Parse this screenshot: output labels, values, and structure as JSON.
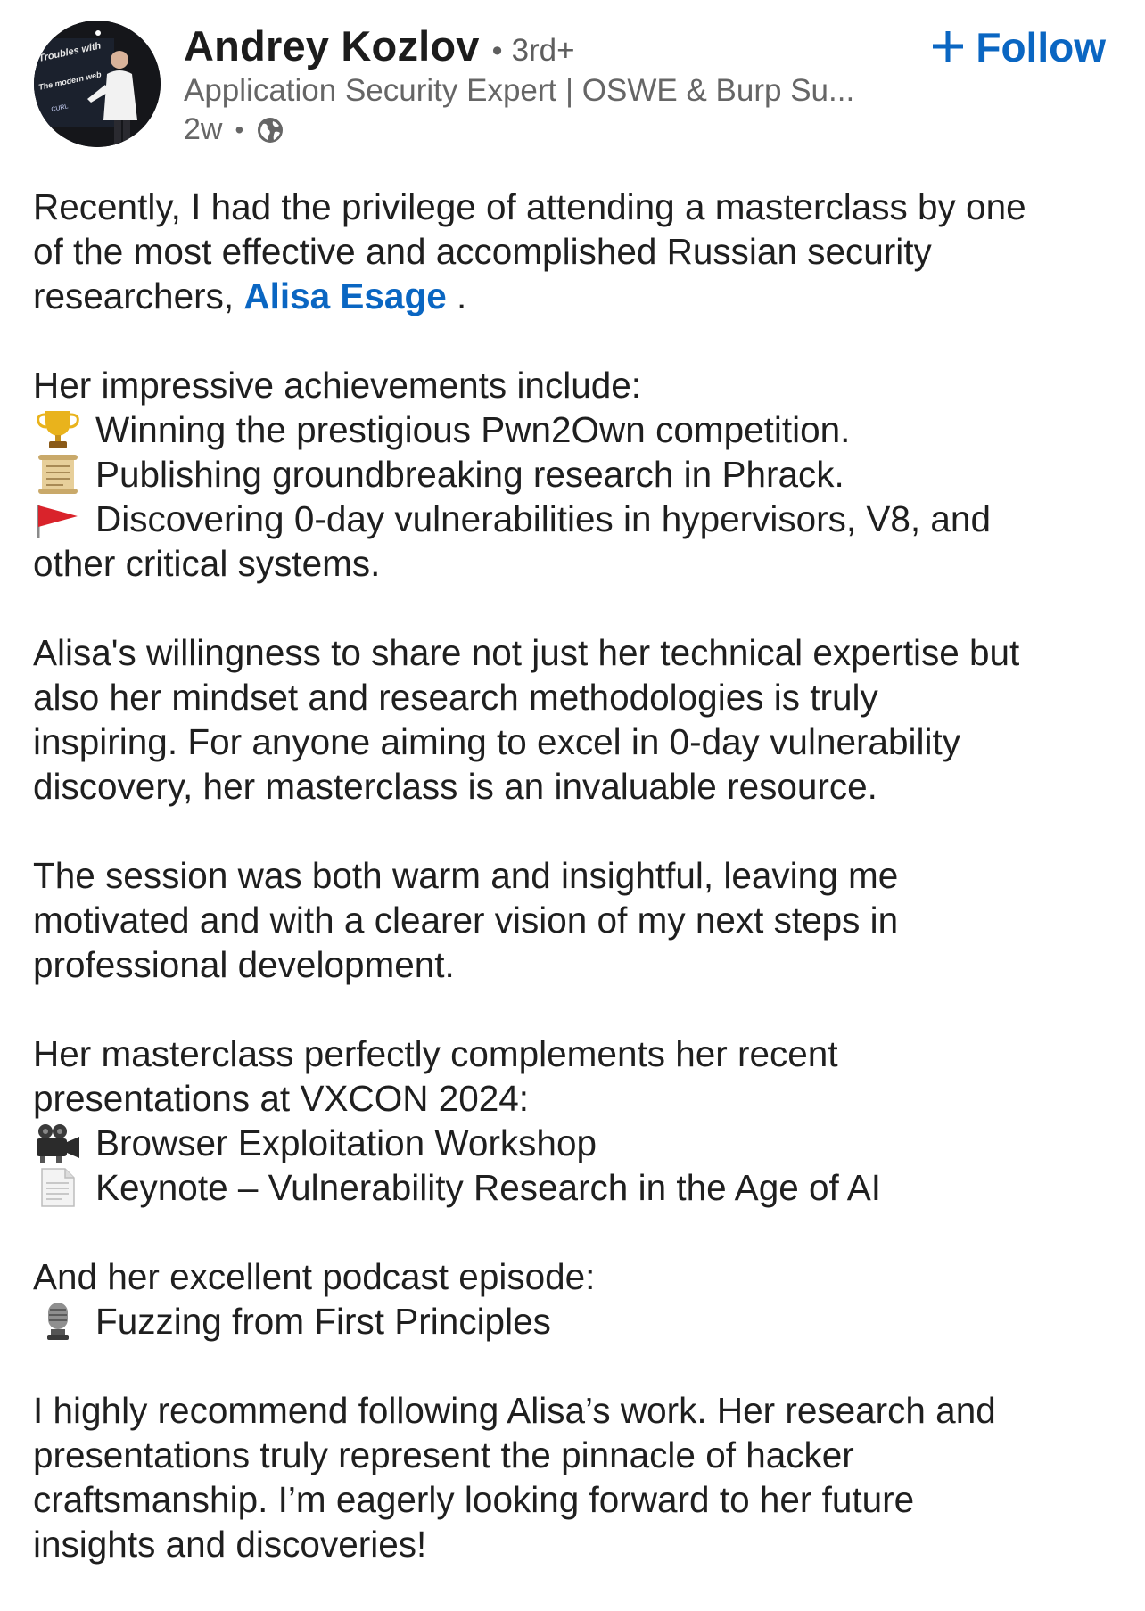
{
  "author": {
    "name": "Andrey Kozlov",
    "degree": "3rd+",
    "headline": "Application Security Expert | OSWE & Burp Su...",
    "time_ago": "2w",
    "avatar_slide_text": [
      "Troubles with",
      "The modern web",
      "CURL"
    ]
  },
  "follow": {
    "label": "Follow",
    "icon": "plus-icon"
  },
  "visibility_icon": "globe-icon",
  "colors": {
    "link": "#0a66c2",
    "text": "#1f1f1f",
    "muted": "#666666"
  },
  "post": {
    "intro": {
      "line1": "Recently, I had the privilege of attending a masterclass by one",
      "line2": "of the most effective and accomplished Russian security",
      "line3_before": "researchers, ",
      "mention": "Alisa Esage",
      "line3_after": " ."
    },
    "achievements": {
      "heading": "Her impressive achievements include:",
      "items": [
        {
          "icon": "trophy-icon",
          "text": "Winning the prestigious Pwn2Own competition."
        },
        {
          "icon": "scroll-icon",
          "text": "Publishing groundbreaking research in Phrack."
        },
        {
          "icon": "flag-icon",
          "text": "Discovering 0-day vulnerabilities in hypervisors, V8, and"
        }
      ],
      "continuation": "other critical systems."
    },
    "para2": [
      "Alisa's willingness to share not just her technical expertise but",
      "also her mindset and research methodologies is truly",
      "inspiring. For anyone aiming to excel in 0-day vulnerability",
      "discovery, her masterclass is an invaluable resource."
    ],
    "para3": [
      "The session was both warm and insightful, leaving me",
      "motivated and with a clearer vision of my next steps in",
      "professional development."
    ],
    "presentations": {
      "lines": [
        "Her masterclass perfectly complements her recent",
        "presentations at VXCON 2024:"
      ],
      "items": [
        {
          "icon": "movie-camera-icon",
          "text": "Browser Exploitation Workshop"
        },
        {
          "icon": "document-icon",
          "text": "Keynote – Vulnerability Research in the Age of AI"
        }
      ]
    },
    "podcast": {
      "heading": "And her excellent podcast episode:",
      "items": [
        {
          "icon": "microphone-icon",
          "text": "Fuzzing from First Principles"
        }
      ]
    },
    "closing": [
      "I highly recommend following Alisa’s work. Her research and",
      "presentations truly represent the pinnacle of hacker",
      "craftsmanship. I’m eagerly looking forward to her future",
      "insights and discoveries!"
    ]
  }
}
